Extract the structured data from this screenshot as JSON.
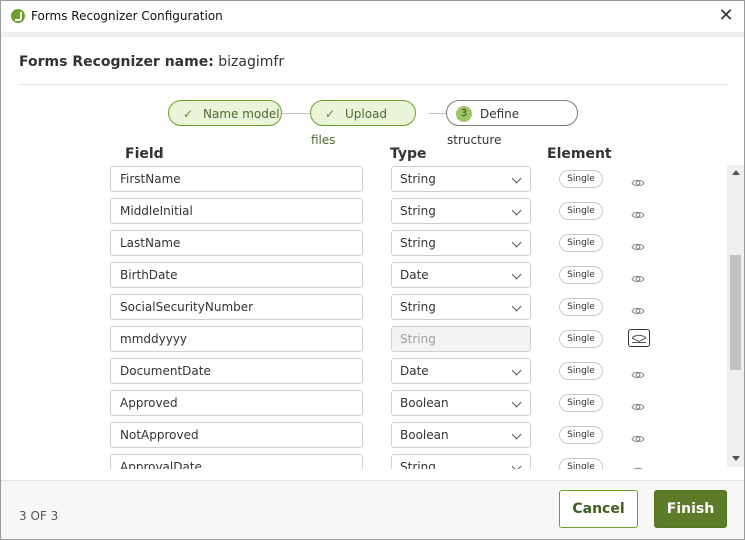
{
  "window": {
    "title": "Forms Recognizer Configuration"
  },
  "header": {
    "name_label": "Forms Recognizer name:",
    "name_value": "bizagimfr"
  },
  "stepper": {
    "steps": [
      {
        "label": "Name model",
        "state": "done"
      },
      {
        "label": "Upload files",
        "state": "done"
      },
      {
        "label": "Define structure",
        "state": "active",
        "number": "3"
      }
    ]
  },
  "grid": {
    "headers": {
      "field": "Field",
      "type": "Type",
      "element": "Element"
    },
    "rows": [
      {
        "field": "FirstName",
        "type": "String",
        "element": "Single",
        "type_disabled": false
      },
      {
        "field": "MiddleInitial",
        "type": "String",
        "element": "Single",
        "type_disabled": false
      },
      {
        "field": "LastName",
        "type": "String",
        "element": "Single",
        "type_disabled": false
      },
      {
        "field": "BirthDate",
        "type": "Date",
        "element": "Single",
        "type_disabled": false
      },
      {
        "field": "SocialSecurityNumber",
        "type": "String",
        "element": "Single",
        "type_disabled": false
      },
      {
        "field": "mmddyyyy",
        "type": "String",
        "element": "Single",
        "type_disabled": true
      },
      {
        "field": "DocumentDate",
        "type": "Date",
        "element": "Single",
        "type_disabled": false
      },
      {
        "field": "Approved",
        "type": "Boolean",
        "element": "Single",
        "type_disabled": false
      },
      {
        "field": "NotApproved",
        "type": "Boolean",
        "element": "Single",
        "type_disabled": false
      },
      {
        "field": "ApprovalDate",
        "type": "String",
        "element": "Single",
        "type_disabled": false
      }
    ]
  },
  "footer": {
    "page_count": "3 OF 3",
    "cancel_label": "Cancel",
    "finish_label": "Finish"
  },
  "colors": {
    "accent": "#6aa22b",
    "finish_bg": "#5d7c2a",
    "step_done_bg": "#e9f4d9"
  }
}
